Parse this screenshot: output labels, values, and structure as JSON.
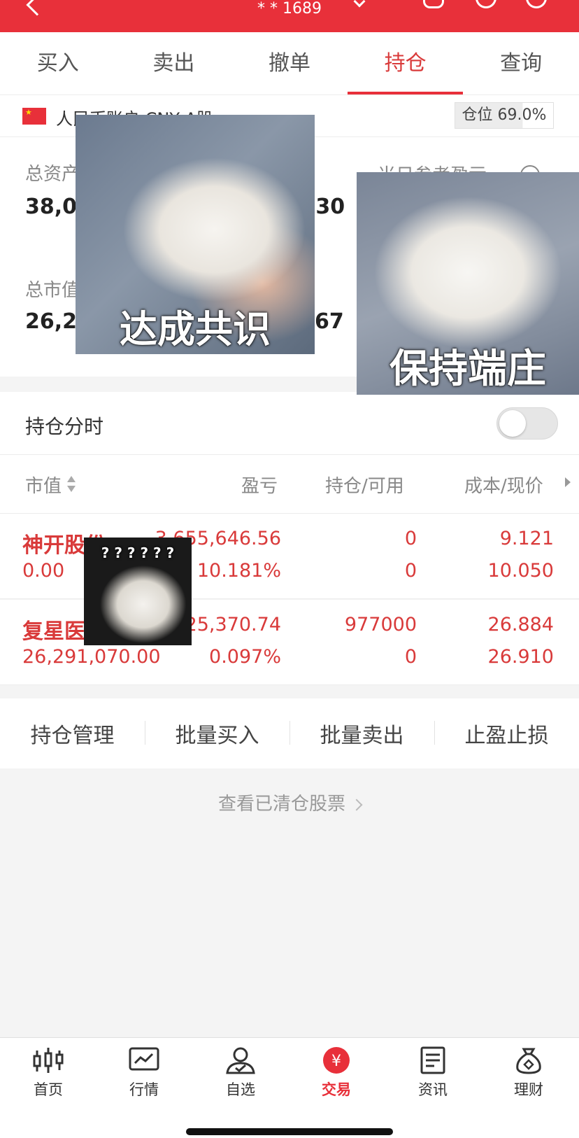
{
  "header": {
    "account_suffix": "* * 1689"
  },
  "tabs": [
    {
      "label": "买入"
    },
    {
      "label": "卖出"
    },
    {
      "label": "撤单"
    },
    {
      "label": "持仓",
      "active": true
    },
    {
      "label": "查询"
    }
  ],
  "account": {
    "name": "人民币账户 CNY A股",
    "position_ratio": "仓位 69.0%",
    "position_value": 69.0
  },
  "summary": {
    "total_assets_label": "总资产",
    "total_assets_value": "38,08",
    "pnl_value": ".30",
    "today_pnl_label": "当日参考盈亏",
    "market_value_label": "总市值",
    "market_value_value": "26,29",
    "available_value": "67"
  },
  "toggle": {
    "label": "持仓分时",
    "on": false
  },
  "table": {
    "headers": {
      "market_value": "市值",
      "pnl": "盈亏",
      "holdings": "持仓/可用",
      "cost_price": "成本/现价"
    },
    "rows": [
      {
        "name": "神开股份",
        "market_value": "0.00",
        "pnl": "3,655,646.56",
        "pnl_pct": "10.181%",
        "holding": "0",
        "available": "0",
        "cost": "9.121",
        "price": "10.050"
      },
      {
        "name": "复星医药",
        "market_value": "26,291,070.00",
        "pnl": "25,370.74",
        "pnl_pct": "0.097%",
        "holding": "977000",
        "available": "0",
        "cost": "26.884",
        "price": "26.910"
      }
    ]
  },
  "actions": [
    {
      "label": "持仓管理"
    },
    {
      "label": "批量买入"
    },
    {
      "label": "批量卖出"
    },
    {
      "label": "止盈止损"
    }
  ],
  "cleared_link": "查看已清仓股票",
  "bottom_nav": [
    {
      "label": "首页",
      "icon": "candlestick-icon"
    },
    {
      "label": "行情",
      "icon": "chart-icon"
    },
    {
      "label": "自选",
      "icon": "user-check-icon"
    },
    {
      "label": "交易",
      "icon": "yuan-icon",
      "active": true
    },
    {
      "label": "资讯",
      "icon": "document-icon"
    },
    {
      "label": "理财",
      "icon": "money-bag-icon"
    }
  ],
  "stickers": {
    "consensus": "达成共识",
    "dignified": "保持端庄",
    "question": "? ? ? ? ? ?"
  },
  "colors": {
    "brand_red": "#e8303a",
    "value_red": "#d93a3a",
    "background": "#f4f4f4"
  }
}
